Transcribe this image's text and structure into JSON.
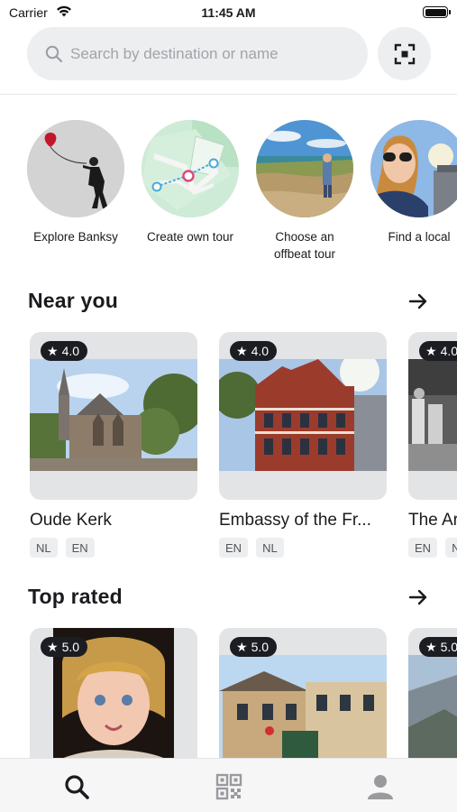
{
  "status_bar": {
    "carrier": "Carrier",
    "time": "11:45 AM"
  },
  "search": {
    "placeholder": "Search by destination or name"
  },
  "stories": [
    {
      "label": "Explore Banksy"
    },
    {
      "label": "Create own tour"
    },
    {
      "label": "Choose an offbeat tour"
    },
    {
      "label": "Find a local"
    }
  ],
  "near_you": {
    "title": "Near you",
    "cards": [
      {
        "rating": "4.0",
        "title": "Oude Kerk",
        "langs": [
          "NL",
          "EN"
        ]
      },
      {
        "rating": "4.0",
        "title": "Embassy of the Fr...",
        "langs": [
          "EN",
          "NL"
        ]
      },
      {
        "rating": "4.0",
        "title": "The Ar",
        "langs": [
          "EN",
          "N"
        ]
      }
    ]
  },
  "top_rated": {
    "title": "Top rated",
    "cards": [
      {
        "rating": "5.0"
      },
      {
        "rating": "5.0"
      },
      {
        "rating": "5.0"
      }
    ]
  },
  "tabs": [
    "search-icon",
    "qr-code-icon",
    "profile-icon"
  ],
  "colors": {
    "accent": "#1c1d22",
    "chip_bg": "#eceef0",
    "badge_bg": "#1c1d22"
  }
}
